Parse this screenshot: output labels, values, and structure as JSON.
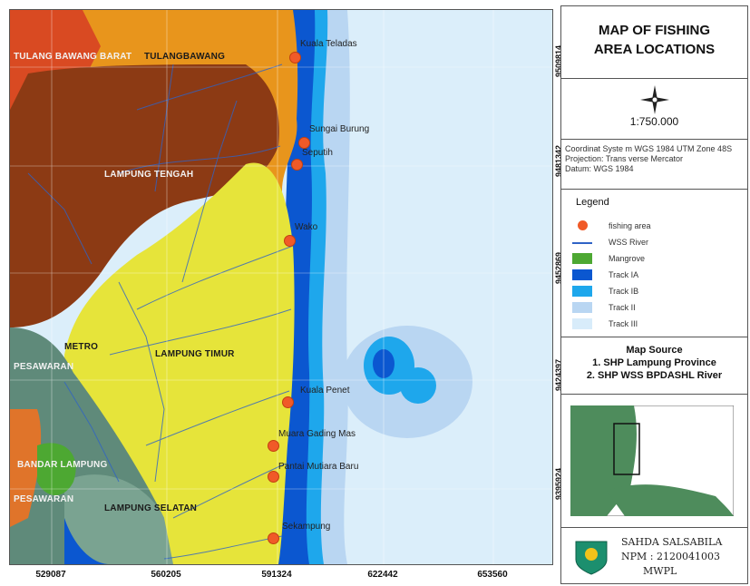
{
  "title": "MAP OF FISHING AREA LOCATIONS",
  "title_lines": [
    "MAP OF FISHING",
    "AREA LOCATIONS"
  ],
  "scale": "1:750.000",
  "coordinate_system": [
    "Coordinat Syste m WGS 1984 UTM Zone 48S",
    "Projection: Trans verse Mercator",
    "Datum: WGS 1984"
  ],
  "legend": {
    "title": "Legend",
    "items": [
      {
        "label": "fishing area",
        "symbol": "circle",
        "color": "#f05a28"
      },
      {
        "label": "WSS River",
        "symbol": "line",
        "color": "#2f63c6"
      },
      {
        "label": "Mangrove",
        "symbol": "fill",
        "color": "#4da832"
      },
      {
        "label": "Track IA",
        "symbol": "fill",
        "color": "#0b57d0"
      },
      {
        "label": "Track IB",
        "symbol": "fill",
        "color": "#1ea7ec"
      },
      {
        "label": "Track II",
        "symbol": "fill",
        "color": "#b9d6f2"
      },
      {
        "label": "Track III",
        "symbol": "fill",
        "color": "#d8ecfa"
      }
    ]
  },
  "map_source": {
    "title": "Map Source",
    "items": [
      "1. SHP Lampung Province",
      "2. SHP WSS BPDASHL River"
    ]
  },
  "author": {
    "name": "SAHDA SALSABILA",
    "npm": "NPM : 2120041003",
    "program": "MWPL"
  },
  "x_ticks": [
    "529087",
    "560205",
    "591324",
    "622442",
    "653560"
  ],
  "y_ticks": [
    "9509814",
    "9481342",
    "9452869",
    "9424397",
    "9395924"
  ],
  "regions": [
    "TULANG BAWANG BARAT",
    "TULANGBAWANG",
    "LAMPUNG TENGAH",
    "METRO",
    "LAMPUNG TIMUR",
    "PESAWARAN",
    "BANDAR LAMPUNG",
    "PESAWARAN",
    "LAMPUNG SELATAN"
  ],
  "fishing_areas": [
    "Kuala Teladas",
    "Sungai Burung",
    "Seputih",
    "Wako",
    "Kuala Penet",
    "Muara Gading Mas",
    "Pantai Mutiara Baru",
    "Sekampung"
  ],
  "colors": {
    "sea": "#dbeefa",
    "track_ia": "#0b57d0",
    "track_ib": "#1ea7ec",
    "track_ii": "#b9d6f2",
    "lampung_timur": "#e6e43a",
    "lampung_tengah": "#8c3a14",
    "tulangbawang": "#e8951c",
    "lampung_selatan": "#6f9c8a"
  }
}
